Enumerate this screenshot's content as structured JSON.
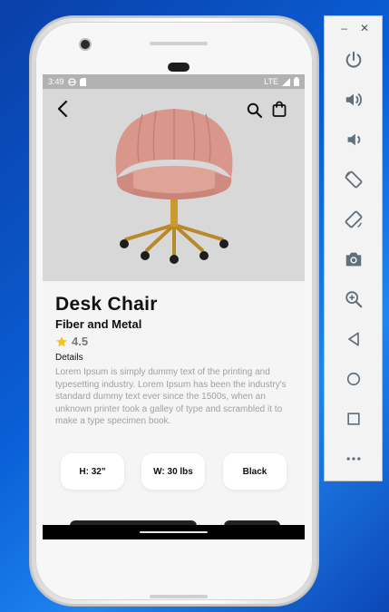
{
  "status_bar": {
    "time": "3:49",
    "network": "LTE"
  },
  "product": {
    "title": "Desk Chair",
    "subtitle": "Fiber and Metal",
    "rating": "4.5",
    "details_label": "Details",
    "description": "Lorem Ipsum is simply dummy text of the printing and typesetting industry. Lorem Ipsum has been the industry's standard dummy text ever since the 1500s, when an unknown printer took a galley of type and scrambled it to make a type specimen book."
  },
  "specs": [
    {
      "label": "H: 32\""
    },
    {
      "label": "W: 30 lbs"
    },
    {
      "label": "Black"
    }
  ],
  "emulator_toolbar": {
    "window_controls": [
      "minimize-icon",
      "close-icon"
    ],
    "minimize_glyph": "–",
    "close_glyph": "✕",
    "buttons": [
      "power-icon",
      "volume-up-icon",
      "volume-down-icon",
      "rotate-left-icon",
      "rotate-right-icon",
      "camera-icon",
      "zoom-icon",
      "back-icon",
      "home-icon",
      "overview-icon",
      "more-icon"
    ]
  },
  "colors": {
    "chair_pink": "#d9978c",
    "chair_gold": "#c99a2e",
    "star": "#f5c518",
    "icon_gray": "#5f6f7b"
  }
}
